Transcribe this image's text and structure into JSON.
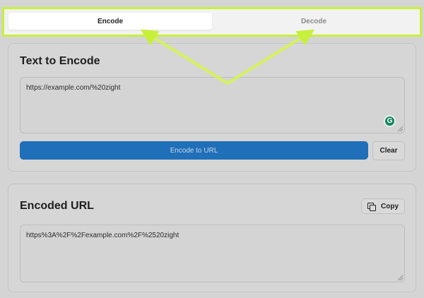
{
  "tabs": [
    {
      "label": "Encode",
      "active": true
    },
    {
      "label": "Decode",
      "active": false
    }
  ],
  "encode_card": {
    "title": "Text to Encode",
    "input_value": "https://example.com/%20zight",
    "primary_button": "Encode to URL",
    "clear_button": "Clear"
  },
  "result_card": {
    "title": "Encoded URL",
    "copy_button": "Copy",
    "output_value": "https%3A%2F%2Fexample.com%2F%2520zight"
  },
  "colors": {
    "highlight": "#c8f03a",
    "primary_button": "#1f6fb9",
    "grammarly": "#15845f"
  }
}
